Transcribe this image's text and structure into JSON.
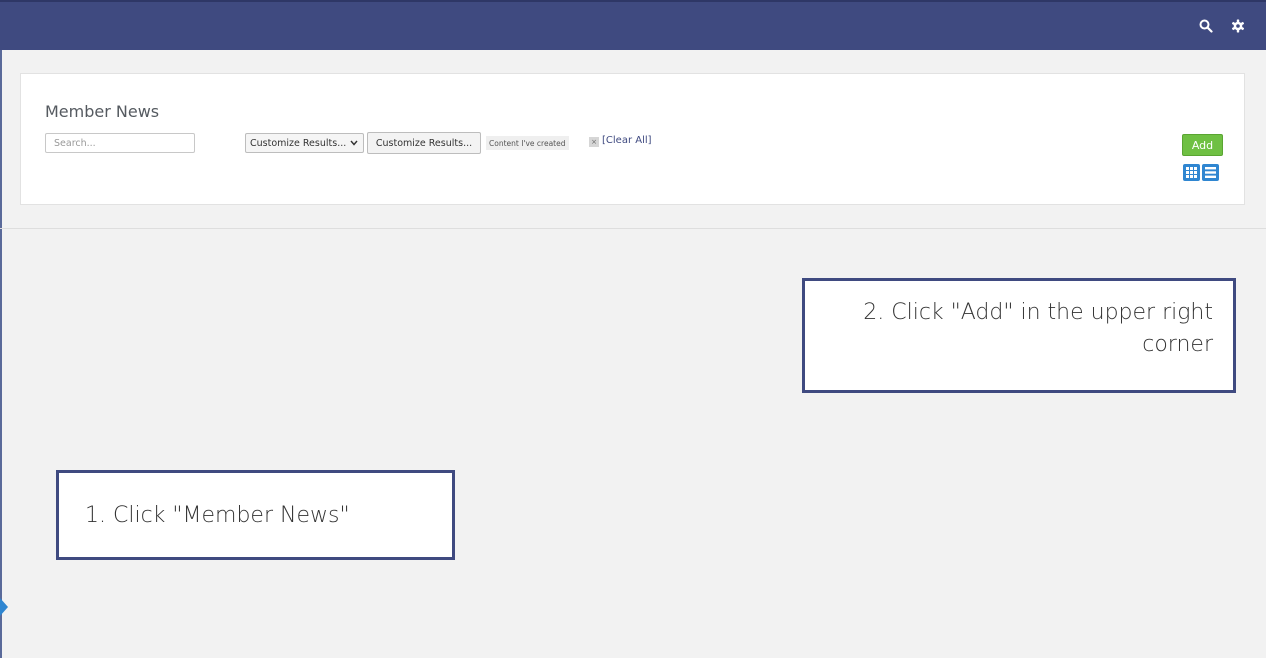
{
  "topbar": {
    "icons": [
      "search-icon",
      "gear-icon"
    ],
    "color": "#3f4a80"
  },
  "panel": {
    "title": "Member News",
    "search": {
      "placeholder": "Search...",
      "value": ""
    },
    "customize_select": {
      "selected": "Customize Results..."
    },
    "customize_button": {
      "label": "Customize Results..."
    },
    "filter_tag": {
      "label": "Content I've created",
      "remove": "×"
    },
    "clear_all": "[Clear All]",
    "add_button": {
      "label": "Add",
      "color": "#6fc043"
    },
    "view_toggles": [
      "grid-view-icon",
      "list-view-icon"
    ]
  },
  "callouts": {
    "step2": "2. Click \"Add\" in the upper right corner",
    "step1": "1. Click \"Member News\""
  },
  "colors": {
    "accent": "#3f4a80",
    "view_button": "#2f86d1"
  }
}
